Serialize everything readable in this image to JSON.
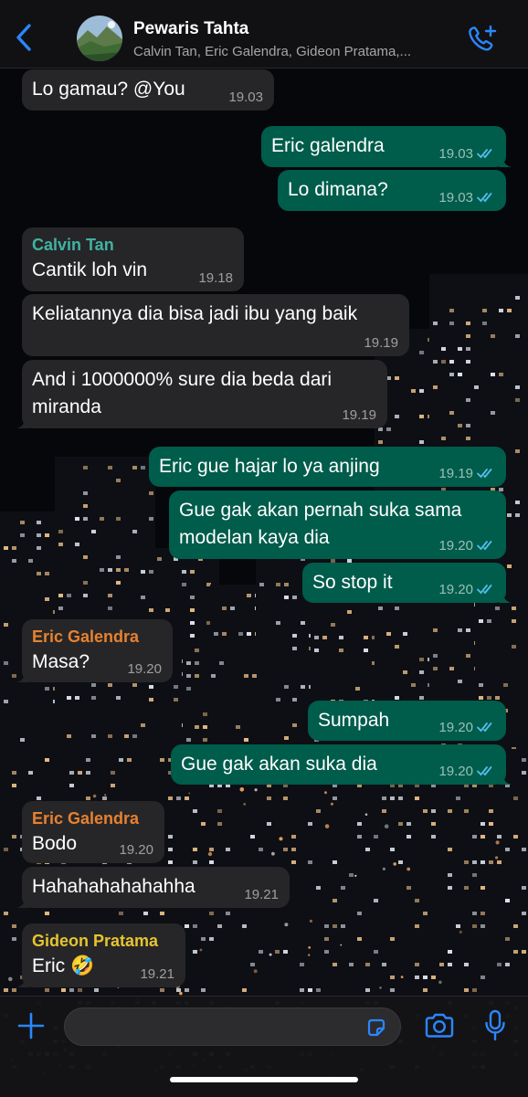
{
  "header": {
    "title": "Pewaris Tahta",
    "subtitle": "Calvin Tan, Eric Galendra, Gideon Pratama,...",
    "back_icon": "chevron-left-icon",
    "call_icon": "add-call-icon"
  },
  "colors": {
    "accent": "#2b86ff",
    "outgoing_bubble": "#005c4b",
    "incoming_bubble": "#262628",
    "read_ticks": "#53bdeb",
    "sender_calvin": "#3fb3a3",
    "sender_eric": "#e8812f",
    "sender_gideon": "#e6c430"
  },
  "messages": [
    {
      "dir": "in",
      "sender": "",
      "text": "Lo gamau? @You",
      "time": "19.03"
    },
    {
      "dir": "out",
      "text": "Eric galendra",
      "time": "19.03"
    },
    {
      "dir": "out",
      "text": "Lo dimana?",
      "time": "19.03"
    },
    {
      "dir": "in",
      "sender": "Calvin Tan",
      "text": "Cantik loh vin",
      "time": "19.18"
    },
    {
      "dir": "in",
      "sender": "",
      "text": "Keliatannya dia bisa jadi ibu yang baik",
      "time": "19.19"
    },
    {
      "dir": "in",
      "sender": "",
      "text": "And i 1000000% sure dia beda dari miranda",
      "time": "19.19"
    },
    {
      "dir": "out",
      "text": "Eric gue hajar lo ya anjing",
      "time": "19.19"
    },
    {
      "dir": "out",
      "text": "Gue gak akan pernah suka sama modelan kaya dia",
      "time": "19.20"
    },
    {
      "dir": "out",
      "text": "So stop it",
      "time": "19.20"
    },
    {
      "dir": "in",
      "sender": "Eric Galendra",
      "text": "Masa?",
      "time": "19.20"
    },
    {
      "dir": "out",
      "text": "Sumpah",
      "time": "19.20"
    },
    {
      "dir": "out",
      "text": "Gue gak akan suka dia",
      "time": "19.20"
    },
    {
      "dir": "in",
      "sender": "Eric Galendra",
      "text": "Bodo",
      "time": "19.20"
    },
    {
      "dir": "in",
      "sender": "",
      "text": "Hahahahahahahha",
      "time": "19.21"
    },
    {
      "dir": "in",
      "sender": "Gideon Pratama",
      "text": "Eric 🤣",
      "time": "19.21"
    }
  ],
  "input": {
    "placeholder": "",
    "plus_icon": "plus-icon",
    "sticker_icon": "sticker-icon",
    "camera_icon": "camera-icon",
    "mic_icon": "microphone-icon"
  }
}
